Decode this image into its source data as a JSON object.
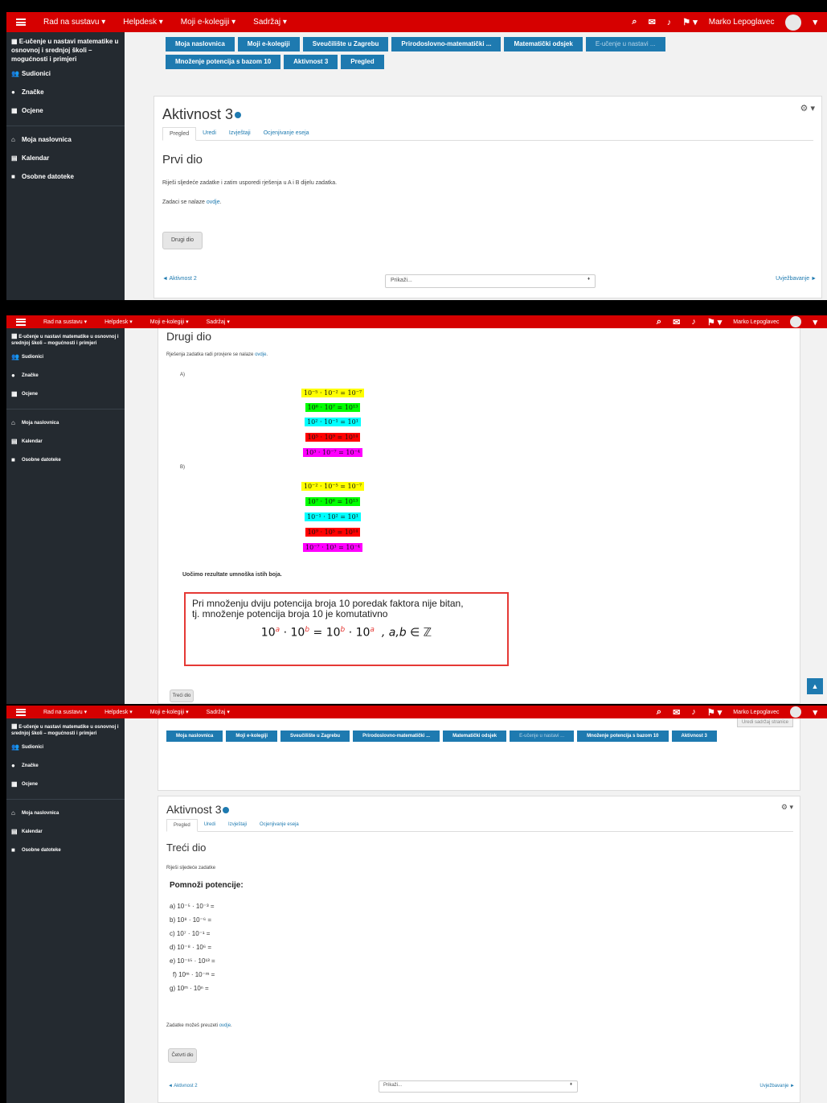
{
  "navbar": {
    "menu1": "Rad na sustavu ▾",
    "menu2": "Helpdesk ▾",
    "menu3": "Moji e-kolegiji ▾",
    "menu4": "Sadržaj ▾",
    "user": "Marko Lepoglavec"
  },
  "sidebar": {
    "course": "E-učenje u nastavi matematike u osnovnoj i srednjoj školi – mogućnosti i primjeri",
    "items": [
      "Sudionici",
      "Značke",
      "Ocjene"
    ],
    "items2": [
      "Moja naslovnica",
      "Kalendar",
      "Osobne datoteke"
    ]
  },
  "crumbs1": [
    "Moja naslovnica",
    "Moji e-kolegiji",
    "Sveučilište u Zagrebu",
    "Prirodoslovno-matematički ...",
    "Matematički odsjek",
    "E-učenje u nastavi ...",
    "Množenje potencija s bazom 10",
    "Aktivnost 3",
    "Pregled"
  ],
  "crumbs3": [
    "Moja naslovnica",
    "Moji e-kolegiji",
    "Sveučilište u Zagrebu",
    "Prirodoslovno-matematički ...",
    "Matematički odsjek",
    "E-učenje u nastavi ...",
    "Množenje potencija s bazom 10",
    "Aktivnost 3"
  ],
  "activity": {
    "title": "Aktivnost 3",
    "tabs": [
      "Pregled",
      "Uredi",
      "Izvještaji",
      "Ocjenjivanje eseja"
    ]
  },
  "page1": {
    "heading": "Prvi dio",
    "text1": "Riješi sljedeće zadatke i zatim usporedi rješenja u A i B dijelu zadatka.",
    "text2_pre": "Zadaci se nalaze",
    "text2_link": "ovdje",
    "button": "Drugi dio",
    "prev": "◄ Aktivnost 2",
    "select": "Prikaži...",
    "next": "Uvježbavanje ►"
  },
  "page2": {
    "heading": "Drugi dio",
    "intro_pre": "Rješenja zadatka radi provjere se nalaze",
    "intro_link": "ovdje",
    "label_a": "A)",
    "label_b": "B)",
    "rows_a": [
      "10⁻⁵ · 10⁻² = 10⁻⁷",
      "10⁶ · 10⁷ = 10¹³",
      "10² · 10⁻¹ = 10¹",
      "10⁵ · 10⁹ = 10¹⁴",
      "10³ · 10⁻⁷ = 10⁻⁴"
    ],
    "rows_b": [
      "10⁻² · 10⁻⁵ = 10⁻⁷",
      "10⁷ · 10⁶ = 10¹³",
      "10⁻¹ · 10² = 10¹",
      "10⁹ · 10⁵ = 10¹⁴",
      "10⁻⁷ · 10³ = 10⁻⁴"
    ],
    "colors": [
      "#ffff00",
      "#00ff00",
      "#00ffff",
      "#ff0000",
      "#ff00ff"
    ],
    "observe": "Uočimo rezultate umnoška istih boja.",
    "box_line1": "Pri množenju dviju potencija broja 10 poredak faktora nije bitan,",
    "box_line2": "tj. množenje potencija broja 10 je komutativno",
    "formula_base": "10",
    "sup_a": "a",
    "sup_b": "b",
    "dot": "·",
    "equals": "=",
    "formula_tail": ", a,b ∈ ℤ",
    "button": "Treći dio"
  },
  "page3": {
    "edit_button": "Uredi sadržaj stranice",
    "heading": "Treći dio",
    "intro": "Riješi sljedeće zadatke",
    "subheading": "Pomnoži potencije:",
    "tasks": [
      "a) 10⁻⁵ · 10⁻³ =",
      "b) 10⁸ · 10⁻⁶ =",
      "c) 10⁷ · 10⁻¹ =",
      "d) 10⁻⁸ · 10⁶ =",
      "e) 10⁻¹⁵ · 10¹³ =",
      "f) 10ᵐ · 10⁻ᵐ =",
      "g) 10ᵐ · 10ⁿ ="
    ],
    "footer_pre": "Zadatke možeš preuzeti",
    "footer_link": "ovdje",
    "button": "Četvrti dio",
    "prev": "◄ Aktivnost 2",
    "select": "Prikaži...",
    "next": "Uvježbavanje ►"
  }
}
